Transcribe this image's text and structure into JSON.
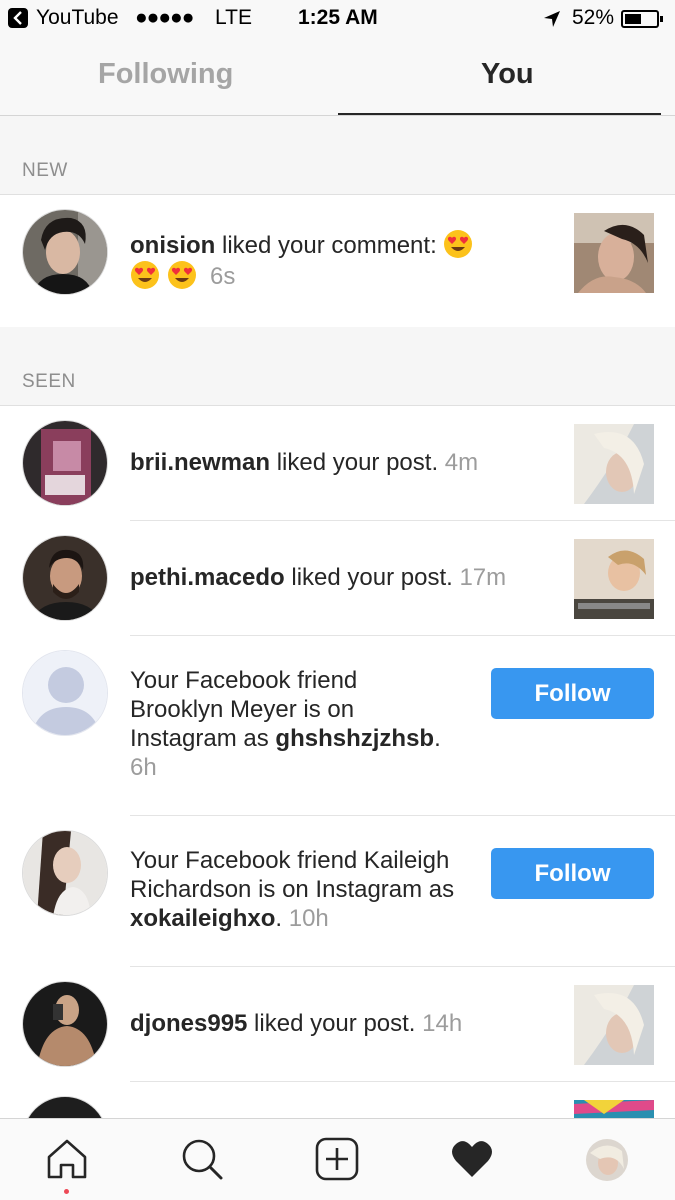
{
  "status_bar": {
    "back_app": "YouTube",
    "signal": "●●●●●",
    "carrier": "LTE",
    "time": "1:25 AM",
    "battery_pct": "52%",
    "battery_level": 0.52
  },
  "tabs": {
    "following": "Following",
    "you": "You",
    "active": "You"
  },
  "sections": {
    "new": "NEW",
    "seen": "SEEN"
  },
  "notifications": [
    {
      "username": "onision",
      "action": " liked your comment: ",
      "time": "6s"
    },
    {
      "username": "brii.newman",
      "action": " liked your post. ",
      "time": "4m"
    },
    {
      "username": "pethi.macedo",
      "action": " liked your post. ",
      "time": "17m"
    },
    {
      "prefix": "Your Facebook friend Brooklyn Meyer is on Instagram as ",
      "username": "ghshshzjzhsb",
      "suffix": ". ",
      "time": "6h",
      "button": "Follow"
    },
    {
      "prefix": "Your Facebook friend Kaileigh Richardson is on Instagram as ",
      "username": "xokaileighxo",
      "suffix": ". ",
      "time": "10h",
      "button": "Follow"
    },
    {
      "username": "djones995",
      "action": " liked your post. ",
      "time": "14h"
    }
  ],
  "bottom_nav": {
    "icons": [
      "home-icon",
      "search-icon",
      "add-post-icon",
      "activity-heart-icon",
      "profile-avatar"
    ],
    "active": "activity-heart-icon"
  },
  "colors": {
    "follow_button": "#3897f0",
    "notification_dot": "#ed4956",
    "heart_emoji": "#f0303b"
  }
}
